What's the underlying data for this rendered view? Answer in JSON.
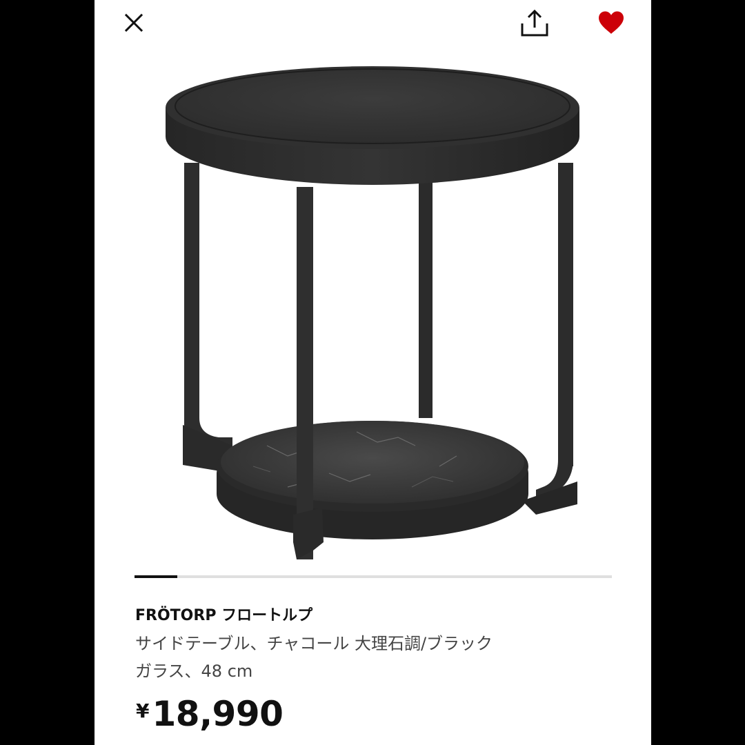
{
  "header": {
    "close_icon": "close-icon",
    "share_icon": "share-icon",
    "favorite_icon": "heart-filled-icon",
    "favorite_color": "#cc0008"
  },
  "gallery": {
    "image_alt": "FRÖTORP side table, charcoal, marble effect / black glass",
    "progress_fraction": 0.09
  },
  "product": {
    "name": "FRÖTORP フロートルプ",
    "description_line1": "サイドテーブル、チャコール 大理石調/ブラック",
    "description_line2": "ガラス、48 cm",
    "price_currency": "¥",
    "price_amount": "18,990"
  }
}
